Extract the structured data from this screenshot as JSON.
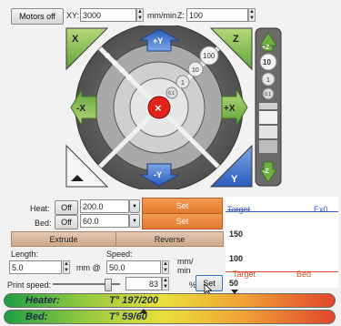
{
  "toolbar": {
    "motors_off_label": "Motors off",
    "xy_label": "XY:",
    "xy_value": "3000",
    "feed_units": "mm/min",
    "z_label": "Z:",
    "z_value": "100"
  },
  "jog": {
    "y_plus": "+Y",
    "y_minus": "-Y",
    "x_plus": "+X",
    "x_minus": "-X",
    "z_plus": "+Z",
    "z_minus": "-Z",
    "home_x": "X",
    "home_y": "Y",
    "home_z": "Z",
    "step_100": "100",
    "step_10": "10",
    "step_1": "1",
    "step_01": "0.1",
    "z_step_10": "10",
    "z_step_1": "1",
    "z_step_01": "0.1",
    "stop_symbol": "×"
  },
  "temps": {
    "heat_label": "Heat:",
    "heat_off": "Off",
    "heat_value": "200.0",
    "heat_set": "Set",
    "bed_label": "Bed:",
    "bed_off": "Off",
    "bed_value": "60.0",
    "bed_set": "Set"
  },
  "extrude": {
    "extrude_label": "Extrude",
    "reverse_label": "Reverse",
    "length_label": "Length:",
    "length_value": "5.0",
    "mm_at": "mm @",
    "speed_label": "Speed:",
    "speed_value": "50.0",
    "speed_units_1": "mm/",
    "speed_units_2": "min"
  },
  "print_speed": {
    "label": "Print speed:",
    "value": "83",
    "percent": "%",
    "set_label": "Set",
    "slider_fraction": 0.83
  },
  "graph": {
    "legend_target_top": "Target",
    "legend_ex0": "Ex0",
    "legend_target_bottom": "Target",
    "legend_bed": "Bed",
    "tick_150": "150",
    "tick_100": "100",
    "tick_50": "50"
  },
  "status": {
    "heater_label": "Heater:",
    "heater_value": "T° 197/200",
    "bed_label": "Bed:",
    "bed_value": "T° 59/60"
  }
}
